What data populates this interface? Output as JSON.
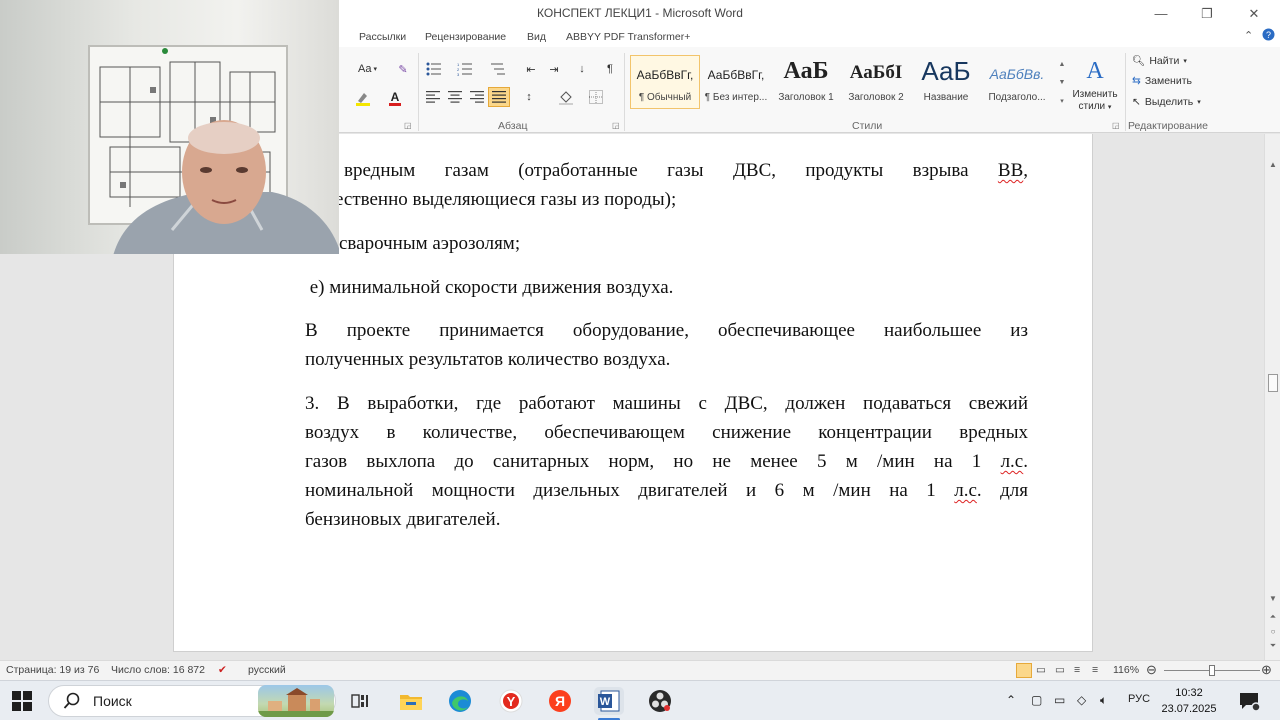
{
  "window": {
    "title": "КОНСПЕКТ  ЛЕКЦИ1 - Microsoft Word",
    "minimize_glyph": "—",
    "restore_glyph": "❐",
    "close_glyph": "✕"
  },
  "ribbon_tabs": [
    "Рассылки",
    "Рецензирование",
    "Вид",
    "ABBYY PDF Transformer+"
  ],
  "ribbon": {
    "font_size_btn": "Aa",
    "paragraph_mark": "¶",
    "group_paragraph": "Абзац",
    "group_styles": "Стили",
    "group_editing": "Редактирование",
    "styles": [
      {
        "preview": "АаБбВвГг,",
        "name": "¶ Обычный",
        "selected": true
      },
      {
        "preview": "АаБбВвГг,",
        "name": "¶ Без интер...",
        "selected": false
      },
      {
        "preview": "АаБ",
        "name": "Заголовок 1",
        "selected": false
      },
      {
        "preview": "АаБбI",
        "name": "Заголовок 2",
        "selected": false
      },
      {
        "preview": "АаБ",
        "name": "Название",
        "selected": false
      },
      {
        "preview": "АаБбВв.",
        "name": "Подзаголо...",
        "selected": false
      }
    ],
    "change_styles": [
      "Изменить",
      "стили"
    ],
    "find": "Найти",
    "replace": "Заменить",
    "select": "Выделить"
  },
  "document": {
    "paragraphs": [
      {
        "id": "p1",
        "lines": [
          "вредным газам (отработанные газы ДВС, продукты взрыва ВВ,",
          "ественно выделяющиеся газы из породы);"
        ]
      },
      {
        "id": "p2",
        "lines": [
          "сварочным аэрозолям;"
        ]
      },
      {
        "id": "p3",
        "lines": [
          " е) минимальной скорости движения воздуха."
        ]
      },
      {
        "id": "p4",
        "lines": [
          " В проекте принимается оборудование, обеспечивающее наибольшее из",
          "полученных результатов количество воздуха."
        ]
      },
      {
        "id": "p5",
        "lines": [
          "3. В выработки, где работают машины с ДВС, должен подаваться свежий",
          "воздух в количестве, обеспечивающем снижение концентрации вредных",
          "газов выхлопа до санитарных норм, но не менее 5 м /мин на 1 л.с.",
          "номинальной мощности дизельных двигателей и 6 м /мин на 1 л.с. для",
          "бензиновых двигателей."
        ]
      }
    ]
  },
  "statusbar": {
    "page": "Страница: 19 из 76",
    "words": "Число слов: 16 872",
    "language": "русский",
    "zoom": "116%",
    "zoom_level_percent": 116
  },
  "taskbar": {
    "search_placeholder": "Поиск",
    "yandex_letter": "Я",
    "y_letter": "Y",
    "word_letter": "W",
    "language": "РУС",
    "time": "10:32",
    "date": "23.07.2025"
  },
  "colors": {
    "ribbon_bg": "#f8f8f8",
    "style_selected_border": "#f2c46b",
    "spell_squiggle": "#dd2222",
    "word_blue": "#2b579a"
  }
}
